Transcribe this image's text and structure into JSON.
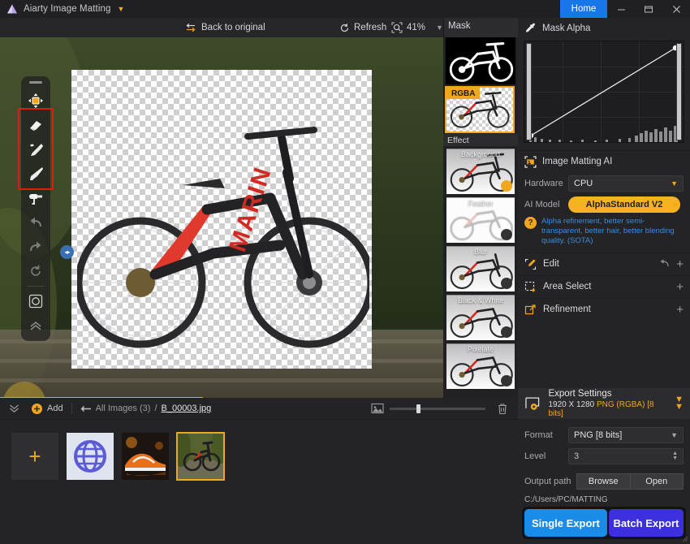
{
  "window": {
    "app_title": "Aiarty Image Matting",
    "home_tab": "Home",
    "minimize": "minimize-icon",
    "maximize": "maximize-icon",
    "close": "close-icon"
  },
  "toolbar": {
    "back_to_original": "Back to original",
    "refresh": "Refresh",
    "zoom_level": "41%"
  },
  "left_tools": [
    {
      "name": "move-tool",
      "glyph": "move",
      "state": "active"
    },
    {
      "name": "eraser-tool",
      "glyph": "eraser",
      "state": "normal"
    },
    {
      "name": "restore-pen-tool",
      "glyph": "pen",
      "state": "normal"
    },
    {
      "name": "brush-tool",
      "glyph": "brush",
      "state": "normal"
    },
    {
      "name": "roller-tool",
      "glyph": "roller",
      "state": "normal"
    },
    {
      "name": "undo-tool",
      "glyph": "undo",
      "state": "dim"
    },
    {
      "name": "redo-tool",
      "glyph": "redo",
      "state": "dim"
    },
    {
      "name": "reset-tool",
      "glyph": "reset",
      "state": "dim"
    },
    {
      "name": "compare-tool",
      "glyph": "compare",
      "state": "normal"
    },
    {
      "name": "collapse-tools",
      "glyph": "chevrons-up",
      "state": "dim"
    }
  ],
  "rail": {
    "mask_label": "Mask",
    "rgba_badge": "RGBA",
    "effect_label": "Effect",
    "effects": [
      {
        "label": "Background",
        "dot": "yellow"
      },
      {
        "label": "Feather",
        "dot": "dark"
      },
      {
        "label": "Blur",
        "dot": "dark"
      },
      {
        "label": "Black & White",
        "dot": "dark"
      },
      {
        "label": "Pixelate",
        "dot": "dark"
      }
    ]
  },
  "mask_alpha": {
    "title": "Mask Alpha",
    "icon": "eyedropper-icon"
  },
  "matting": {
    "title": "Image Matting AI",
    "hardware_label": "Hardware",
    "hardware_value": "CPU",
    "model_label": "AI Model",
    "model_value": "AlphaStandard  V2",
    "hint": "Alpha refinement, better semi-transparent, better hair, better blending quality. (SOTA)",
    "hint_color": "#3d8bd8",
    "accent": "#f0a71d"
  },
  "sections": [
    {
      "label": "Edit",
      "icon": "edit-icon",
      "has_undo": true
    },
    {
      "label": "Area Select",
      "icon": "area-select-icon",
      "has_undo": false
    },
    {
      "label": "Refinement",
      "icon": "refinement-icon",
      "has_undo": false
    }
  ],
  "export": {
    "title": "Export Settings",
    "dimensions": "1920 X 1280",
    "format_summary": "PNG (RGBA) [8 bits]",
    "format_label": "Format",
    "format_value": "PNG  [8 bits]",
    "level_label": "Level",
    "level_value": "3",
    "output_path_label": "Output path",
    "browse_label": "Browse",
    "open_label": "Open",
    "output_path": "C:/Users/PC/MATTING",
    "single_export": "Single Export",
    "batch_export": "Batch Export",
    "single_color": "#1a8ce8",
    "batch_color": "#3b2fe0"
  },
  "bottom": {
    "collapse_icon": "chevrons-down-icon",
    "add_label": "Add",
    "back_icon": "arrow-left-icon",
    "all_images": "All Images (3)",
    "separator": "/",
    "current_file": "B_00003.jpg",
    "thumb_size_icon": "image-size-icon",
    "delete_icon": "trash-icon",
    "slider_value": 28
  },
  "filmstrip": {
    "add_label": "+",
    "items": [
      {
        "name": "thumb-globe",
        "selected": false
      },
      {
        "name": "thumb-sneaker",
        "selected": false
      },
      {
        "name": "thumb-bike",
        "selected": true
      }
    ]
  }
}
